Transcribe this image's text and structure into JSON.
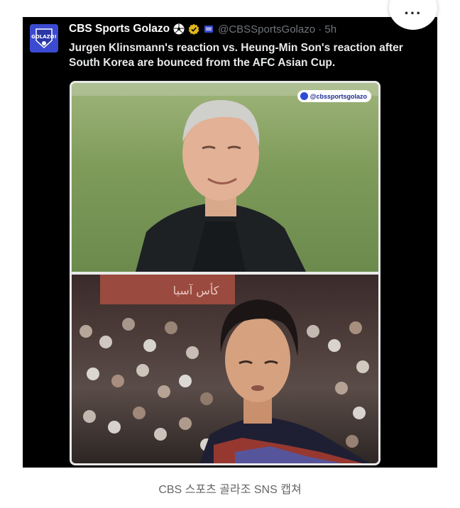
{
  "more_button": {
    "icon": "more-horizontal-icon",
    "label": "···"
  },
  "tweet": {
    "author_name": "CBS Sports Golazo",
    "handle_time": "@CBSSportsGolazo · 5h",
    "text": "Jurgen Klinsmann's reaction vs. Heung-Min Son's reaction after South Korea are bounced from the AFC Asian Cup.",
    "badges": [
      "soccer-ball-icon",
      "verified-gold-icon",
      "flag-icon"
    ],
    "avatar_logo_text": "GOLAZO!"
  },
  "media": {
    "watermark": "@cbssportsgolazo",
    "stadium_sign": "كأس آسيا"
  },
  "caption": "CBS 스포츠 골라조 SNS 캡쳐",
  "colors": {
    "card_bg": "#000000",
    "name": "#ffffff",
    "handle": "#71767b",
    "avatar": "#3a4bd1"
  }
}
